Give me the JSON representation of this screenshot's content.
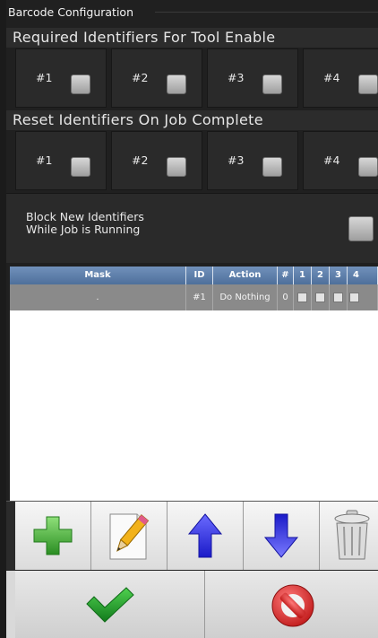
{
  "window": {
    "title": "Barcode Configuration"
  },
  "required": {
    "heading": "Required Identifiers For Tool Enable",
    "items": [
      {
        "label": "#1",
        "checked": false
      },
      {
        "label": "#2",
        "checked": false
      },
      {
        "label": "#3",
        "checked": false
      },
      {
        "label": "#4",
        "checked": false
      }
    ]
  },
  "reset": {
    "heading": "Reset Identifiers On Job Complete",
    "items": [
      {
        "label": "#1",
        "checked": false
      },
      {
        "label": "#2",
        "checked": false
      },
      {
        "label": "#3",
        "checked": false
      },
      {
        "label": "#4",
        "checked": false
      }
    ]
  },
  "block": {
    "line1": "Block New Identifiers",
    "line2": "While Job is Running",
    "checked": false
  },
  "table": {
    "columns": [
      "Mask",
      "ID",
      "Action",
      "#",
      "1",
      "2",
      "3",
      "4"
    ],
    "rows": [
      {
        "mask": ".",
        "id": "#1",
        "action": "Do Nothing",
        "count": "0"
      }
    ]
  },
  "toolbar": {
    "icons": [
      "plus-icon",
      "pencil-icon",
      "arrow-up-icon",
      "arrow-down-icon",
      "trash-icon"
    ],
    "colors": {
      "add": "#3aa32f",
      "up": "#2323d6",
      "down": "#3a3ad8"
    }
  },
  "bottom": {
    "icons": [
      "checkmark-icon",
      "cancel-icon"
    ],
    "colors": {
      "ok": "#1f9a2a",
      "cancel": "#d42424"
    }
  }
}
